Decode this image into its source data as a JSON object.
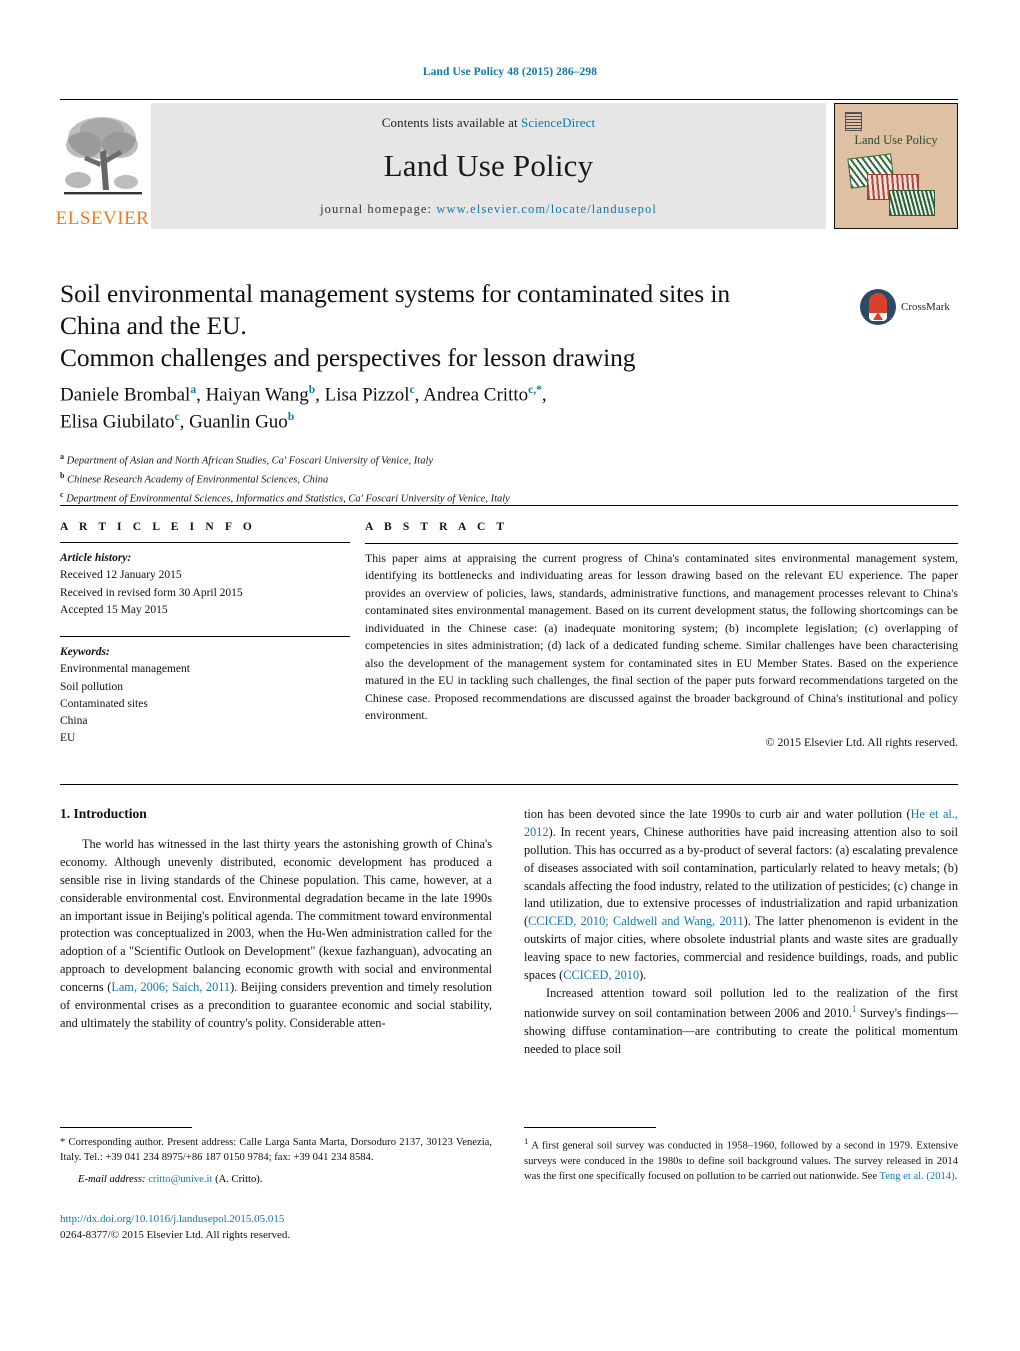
{
  "running_head": "Land Use Policy 48 (2015) 286–298",
  "masthead": {
    "publisher": "ELSEVIER",
    "contents_prefix": "Contents lists available at ",
    "contents_link": "ScienceDirect",
    "journal_name": "Land Use Policy",
    "homepage_prefix": "journal homepage: ",
    "homepage_link": "www.elsevier.com/locate/landusepol",
    "cover_title": "Land Use Policy"
  },
  "article": {
    "title_line1": "Soil environmental management systems for contaminated sites in",
    "title_line2": "China and the EU.",
    "title_line3": "Common challenges and perspectives for lesson drawing",
    "crossmark_label": "CrossMark",
    "authors_line1_pre": "Daniele Brombal",
    "authors": [
      {
        "name": "Daniele Brombal",
        "marks": "a"
      },
      {
        "name": "Haiyan Wang",
        "marks": "b"
      },
      {
        "name": "Lisa Pizzol",
        "marks": "c"
      },
      {
        "name": "Andrea Critto",
        "marks": "c,*"
      },
      {
        "name": "Elisa Giubilato",
        "marks": "c"
      },
      {
        "name": "Guanlin Guo",
        "marks": "b"
      }
    ],
    "affiliations": [
      {
        "mark": "a",
        "text": "Department of Asian and North African Studies, Ca' Foscari University of Venice, Italy"
      },
      {
        "mark": "b",
        "text": "Chinese Research Academy of Environmental Sciences, China"
      },
      {
        "mark": "c",
        "text": "Department of Environmental Sciences, Informatics and Statistics, Ca' Foscari University of Venice, Italy"
      }
    ]
  },
  "article_info": {
    "heading": "A R T I C L E   I N F O",
    "history_label": "Article history:",
    "history": [
      "Received 12 January 2015",
      "Received in revised form 30 April 2015",
      "Accepted 15 May 2015"
    ],
    "keywords_label": "Keywords:",
    "keywords": [
      "Environmental management",
      "Soil pollution",
      "Contaminated sites",
      "China",
      "EU"
    ]
  },
  "abstract": {
    "heading": "A B S T R A C T",
    "text": "This paper aims at appraising the current progress of China's contaminated sites environmental management system, identifying its bottlenecks and individuating areas for lesson drawing based on the relevant EU experience. The paper provides an overview of policies, laws, standards, administrative functions, and management processes relevant to China's contaminated sites environmental management. Based on its current development status, the following shortcomings can be individuated in the Chinese case: (a) inadequate monitoring system; (b) incomplete legislation; (c) overlapping of competencies in sites administration; (d) lack of a dedicated funding scheme. Similar challenges have been characterising also the development of the management system for contaminated sites in EU Member States. Based on the experience matured in the EU in tackling such challenges, the final section of the paper puts forward recommendations targeted on the Chinese case. Proposed recommendations are discussed against the broader background of China's institutional and policy environment.",
    "copyright": "© 2015 Elsevier Ltd. All rights reserved."
  },
  "body": {
    "section_number_title": "1.  Introduction",
    "left_para1_a": "The world has witnessed in the last thirty years the astonishing growth of China's economy. Although unevenly distributed, economic development has produced a sensible rise in living standards of the Chinese population. This came, however, at a considerable environmental cost. Environmental degradation became in the late 1990s an important issue in Beijing's political agenda. The commitment toward environmental protection was conceptualized in 2003, when the Hu-Wen administration called for the adoption of a \"Scientific Outlook on Development\" (kexue fazhanguan), advocating an approach to development balancing economic growth with social and environmental concerns (",
    "left_ref1": "Lam, 2006; Saich, 2011",
    "left_para1_b": "). Beijing considers prevention and timely resolution of environmental crises as a precondition to guarantee economic and social stability, and ultimately the stability of country's polity. Considerable atten-",
    "right_para1_a": "tion has been devoted since the late 1990s to curb air and water pollution (",
    "right_ref1": "He et al., 2012",
    "right_para1_b": "). In recent years, Chinese authorities have paid increasing attention also to soil pollution. This has occurred as a by-product of several factors: (a) escalating prevalence of diseases associated with soil contamination, particularly related to heavy metals; (b) scandals affecting the food industry, related to the utilization of pesticides; (c) change in land utilization, due to extensive processes of industrialization and rapid urbanization (",
    "right_ref2": "CCICED, 2010; Caldwell and Wang, 2011",
    "right_para1_c": "). The latter phenomenon is evident in the outskirts of major cities, where obsolete industrial plants and waste sites are gradually leaving space to new factories, commercial and residence buildings, roads, and public spaces (",
    "right_ref3": "CCICED, 2010",
    "right_para1_d": ").",
    "right_para2_a": "Increased attention toward soil pollution led to the realization of the first nationwide survey on soil contamination between 2006 and 2010.",
    "right_para2_fnmark": "1",
    "right_para2_b": " Survey's findings—showing diffuse contamination—are contributing to create the political momentum needed to place soil"
  },
  "footnotes": {
    "corresponding": "*  Corresponding author. Present address: Calle Larga Santa Marta, Dorsoduro 2137, 30123 Venezia, Italy. Tel.: +39 041 234 8975/+86 187 0150 9784; fax: +39 041 234 8584.",
    "email_label": "E-mail address:",
    "email": "critto@unive.it",
    "email_suffix": " (A. Critto).",
    "note1_mark": "1",
    "note1_a": "  A first general soil survey was conducted in 1958–1960, followed by a second in 1979. Extensive surveys were conduced in the 1980s to define soil background values. The survey released in 2014 was the first one specifically focused on pollution to be carried out nationwide. See ",
    "note1_ref": "Teng et al. (2014)",
    "note1_b": "."
  },
  "doi": {
    "url": "http://dx.doi.org/10.1016/j.landusepol.2015.05.015",
    "issn_line": "0264-8377/© 2015 Elsevier Ltd. All rights reserved."
  },
  "colors": {
    "link": "#1178a8",
    "elsevier_orange": "#f07c19",
    "band_gray": "#e6e6e6",
    "cover_tan": "#dfc0a2"
  }
}
